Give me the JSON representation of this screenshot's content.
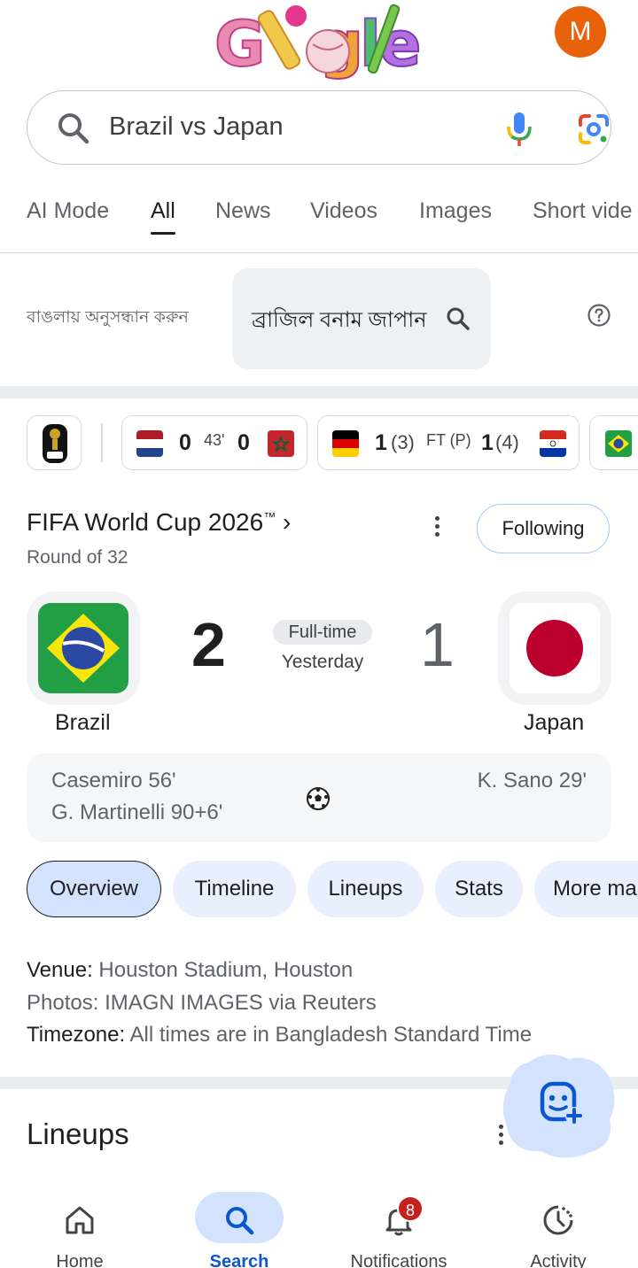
{
  "header": {
    "avatar_letter": "M",
    "doodle_icon": "google-cricket-doodle-icon"
  },
  "search": {
    "query": "Brazil vs Japan"
  },
  "tabs": [
    {
      "label": "AI Mode"
    },
    {
      "label": "All",
      "active": true
    },
    {
      "label": "News"
    },
    {
      "label": "Videos"
    },
    {
      "label": "Images"
    },
    {
      "label": "Short vide"
    }
  ],
  "bangla": {
    "prompt": "বাঙলায় অনুসন্ধান করুন",
    "chip": "ব্রাজিল বনাম জাপান"
  },
  "score_strip": {
    "match1": {
      "home_score": "0",
      "minute": "43'",
      "away_score": "0"
    },
    "match2": {
      "home_score": "1",
      "home_pens": "(3)",
      "status": "FT (P)",
      "away_score": "1",
      "away_pens": "(4)"
    }
  },
  "tournament": {
    "title": "FIFA World Cup 2026",
    "trademark": "™",
    "chevron": "›",
    "round": "Round of 32",
    "follow_label": "Following"
  },
  "match": {
    "home": {
      "name": "Brazil",
      "score": "2"
    },
    "away": {
      "name": "Japan",
      "score": "1"
    },
    "status": "Full-time",
    "when": "Yesterday",
    "home_scorers": [
      "Casemiro 56'",
      "G. Martinelli 90+6'"
    ],
    "away_scorers": [
      "K. Sano 29'"
    ]
  },
  "chips": [
    "Overview",
    "Timeline",
    "Lineups",
    "Stats",
    "More ma"
  ],
  "info": {
    "venue_label": "Venue:",
    "venue_value": "Houston Stadium, Houston",
    "photos_label": "Photos:",
    "photos_value": "IMAGN IMAGES via Reuters",
    "timezone_label": "Timezone:",
    "timezone_value": "All times are in Bangladesh Standard Time"
  },
  "lineups_title": "Lineups",
  "bottom_nav": [
    {
      "label": "Home",
      "icon": "home-icon"
    },
    {
      "label": "Search",
      "icon": "search-icon",
      "active": true
    },
    {
      "label": "Notifications",
      "icon": "bell-icon",
      "badge": "8"
    },
    {
      "label": "Activity",
      "icon": "activity-icon"
    }
  ],
  "colors": {
    "accent": "#0b57d0",
    "avatar": "#e8620c",
    "chip_bg": "#e8f0fe",
    "badge": "#c5221f"
  }
}
